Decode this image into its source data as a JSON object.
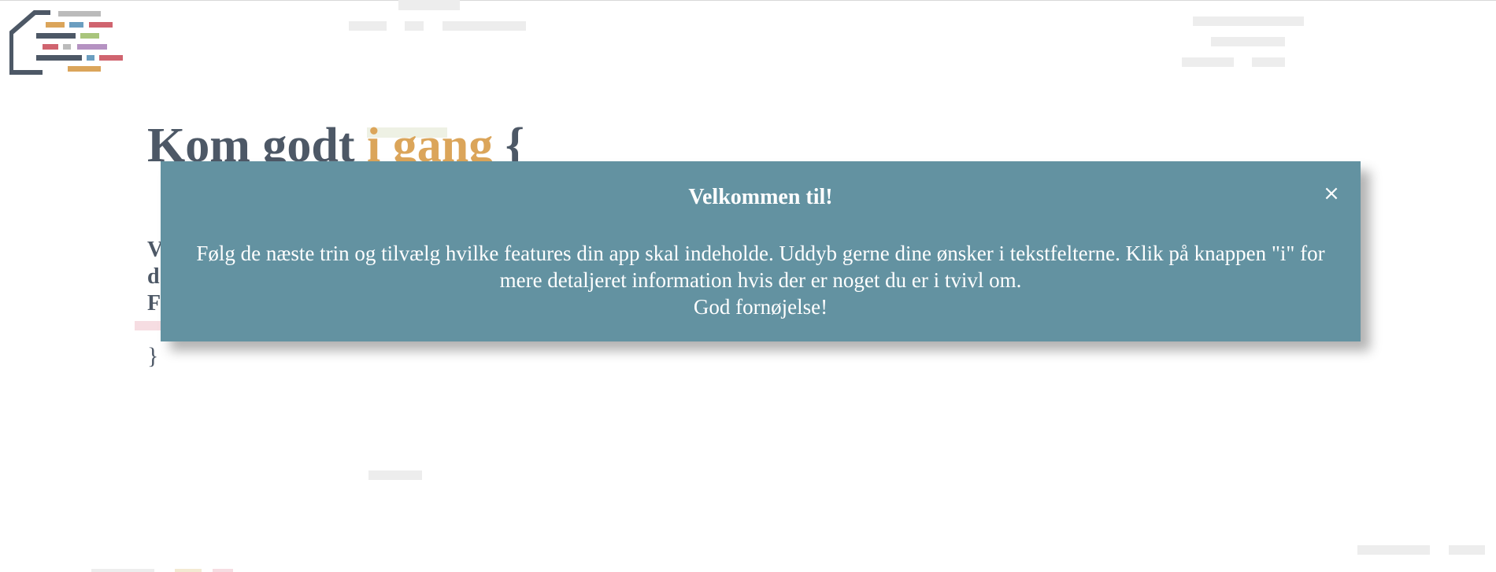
{
  "header": {
    "logo_icon": "code-logo-icon",
    "colors": {
      "slate": "#4d5866",
      "orange": "#dba55a",
      "blue": "#6b9ec0",
      "red": "#d0646f",
      "green": "#a9c57c",
      "purple": "#b592c2",
      "grey": "#bbbbbb"
    }
  },
  "hero": {
    "title_main": "Kom godt ",
    "title_accent": "i gang",
    "title_brace": " {",
    "intro_letters": [
      "V",
      "d",
      "F"
    ],
    "closing_brace": "}"
  },
  "modal": {
    "title": "Velkommen til!",
    "close_label": "×",
    "body_line1": "Følg de næste trin og tilvælg hvilke features din app skal indeholde. Uddyb gerne dine ønsker i tekstfelterne. Klik på knappen \"i\" for mere detaljeret information hvis der er noget du er i tvivl om.",
    "body_line2": "God fornøjelse!",
    "background_color": "#6392a1"
  }
}
